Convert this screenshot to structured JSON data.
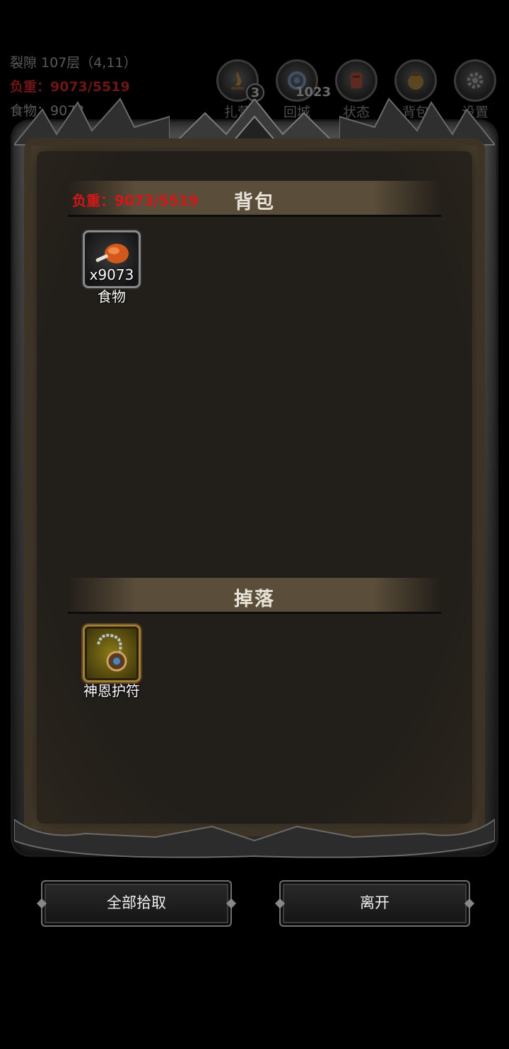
{
  "hud": {
    "location": "裂隙 107层（4,11）",
    "weight": "负重：9073/5519",
    "food": "食物：9073"
  },
  "hud_buttons": [
    {
      "label": "扎营",
      "count": "3",
      "icon": "campfire-icon"
    },
    {
      "label": "回城",
      "count": "1023",
      "icon": "portal-icon"
    },
    {
      "label": "状态",
      "count": "",
      "icon": "status-icon"
    },
    {
      "label": "背包",
      "count": "",
      "icon": "bag-icon"
    },
    {
      "label": "设置",
      "count": "",
      "icon": "gear-icon"
    }
  ],
  "backpack": {
    "title": "背包",
    "weight": "负重：9073/5519",
    "items": [
      {
        "name": "食物",
        "qty": "x9073",
        "icon": "meat-icon"
      }
    ]
  },
  "drops": {
    "title": "掉落",
    "items": [
      {
        "name": "神恩护符",
        "icon": "amulet-icon"
      }
    ]
  },
  "buttons": {
    "pickup_all": "全部拾取",
    "leave": "离开"
  },
  "colors": {
    "weight_red": "#d01818",
    "header_bar": "#5a4d39",
    "slot_gold": "#8a7a18"
  }
}
